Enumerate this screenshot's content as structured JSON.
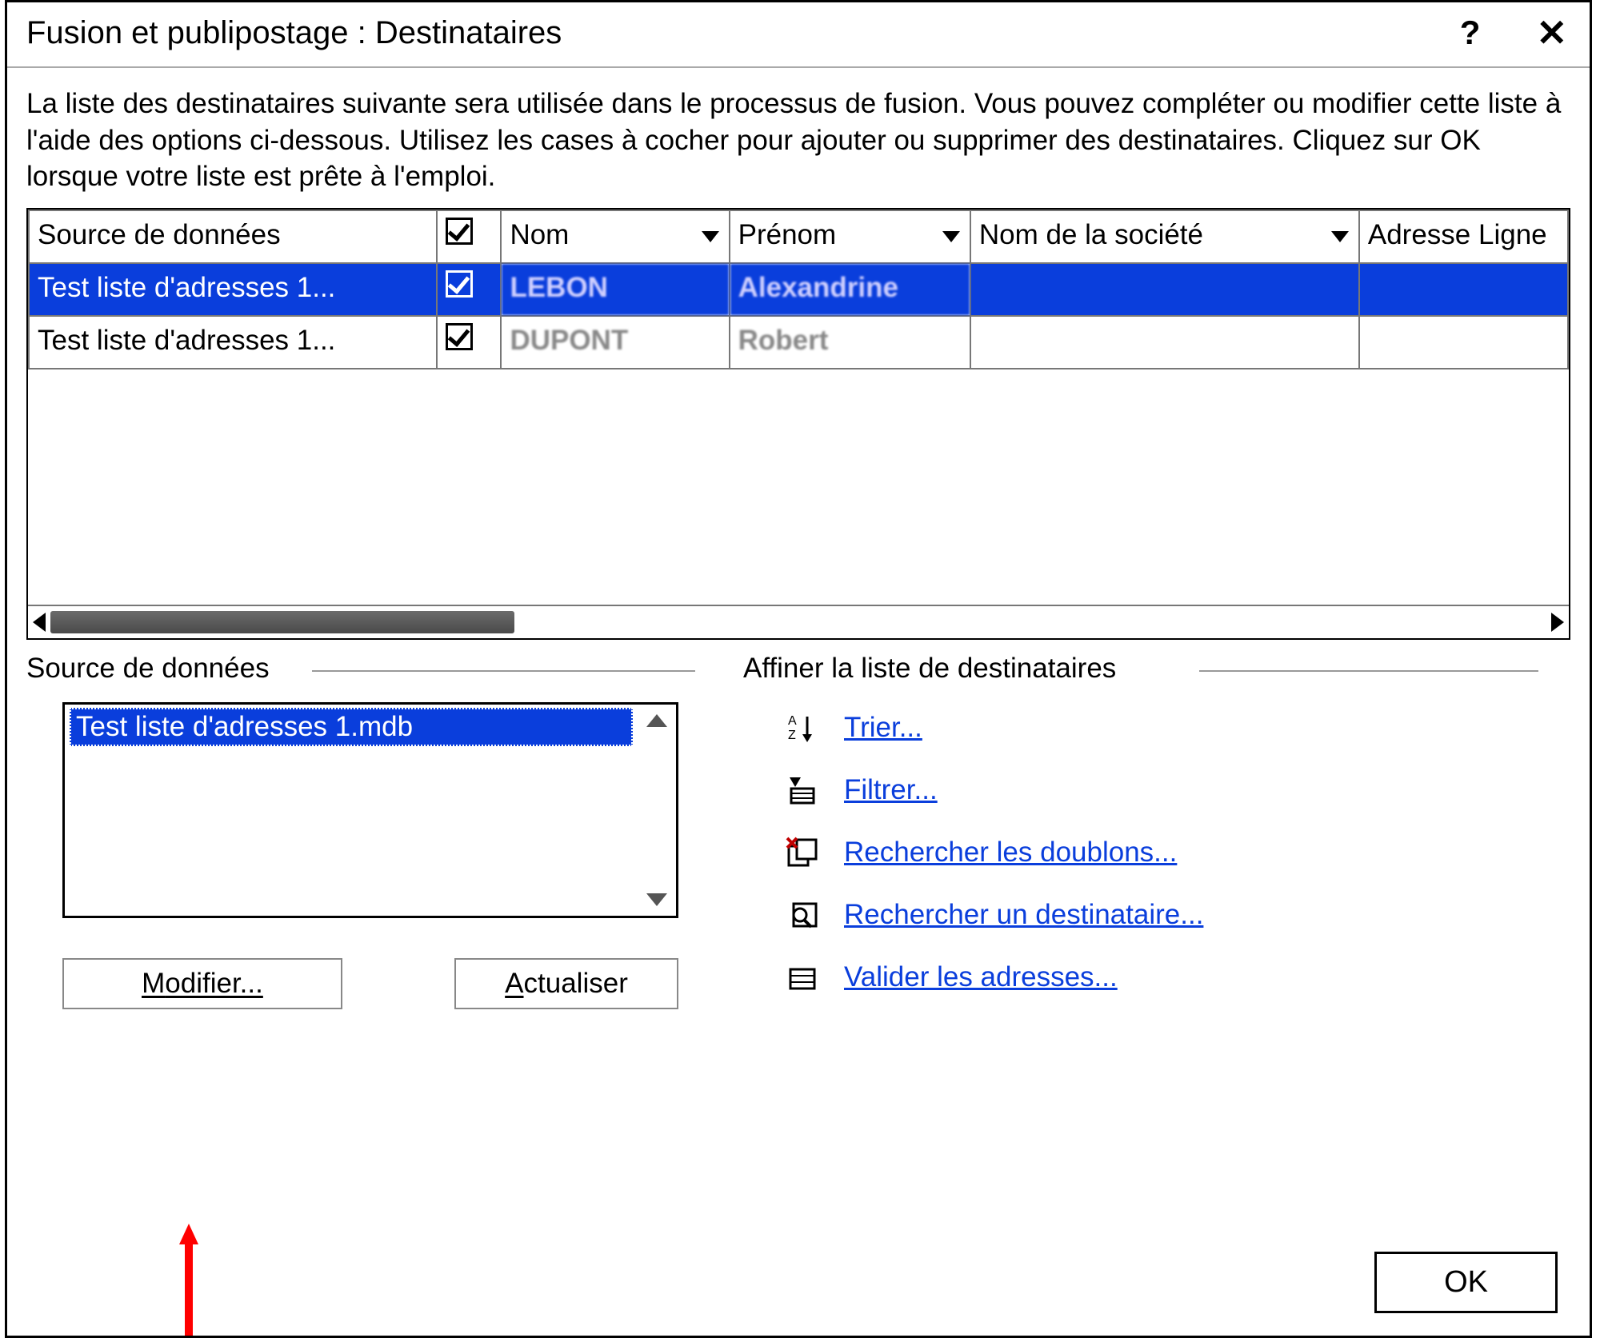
{
  "title": "Fusion et publipostage : Destinataires",
  "description": "La liste des destinataires suivante sera utilisée dans le processus de fusion. Vous pouvez compléter ou modifier cette liste à l'aide des options ci-dessous. Utilisez les cases à cocher pour ajouter ou supprimer des destinataires. Cliquez sur OK lorsque votre liste est prête à l'emploi.",
  "columns": {
    "source": "Source de données",
    "nom": "Nom",
    "prenom": "Prénom",
    "societe": "Nom de la société",
    "adresse": "Adresse Ligne"
  },
  "rows": [
    {
      "source": "Test liste d'adresses 1...",
      "checked": true,
      "nom": "LEBON",
      "prenom": "Alexandrine",
      "societe": "",
      "adresse": "",
      "selected": true
    },
    {
      "source": "Test liste d'adresses 1...",
      "checked": true,
      "nom": "DUPONT",
      "prenom": "Robert",
      "societe": "",
      "adresse": "",
      "selected": false
    }
  ],
  "sourceGroup": {
    "label": "Source de données",
    "selected": "Test liste d'adresses 1.mdb",
    "modify": "Modifier...",
    "refresh": "Actualiser"
  },
  "refineGroup": {
    "label": "Affiner la liste de destinataires",
    "sort": "Trier...",
    "filter": "Filtrer...",
    "dupes": "Rechercher les doublons...",
    "find": "Rechercher un destinataire...",
    "validate": "Valider les adresses..."
  },
  "ok": "OK"
}
